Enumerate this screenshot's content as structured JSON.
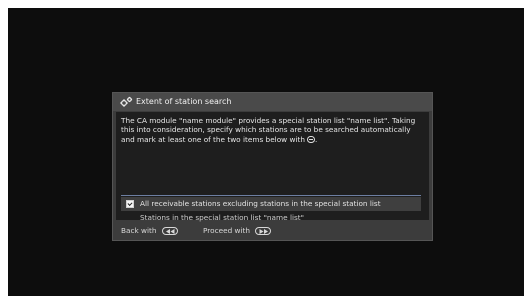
{
  "dialog": {
    "title": "Extent of station search",
    "title_icon": "gears-icon",
    "description": "The CA module \"name module\" provides a special station list \"name list\". Taking this into consideration, specify which stations are to be searched automatically and mark at least one of the two items below with",
    "description_end": ".",
    "ok_icon": "ok-button-icon"
  },
  "options": [
    {
      "label": "All receivable stations excluding stations in the special station list",
      "checked": true
    },
    {
      "label": "Stations in the special station list \"name list\""
    }
  ],
  "footer": {
    "back_label": "Back with",
    "back_icon": "rewind-key-icon",
    "proceed_label": "Proceed with",
    "proceed_icon": "fast-forward-key-icon"
  },
  "colors": {
    "screen_background": "#0d0d0d",
    "dialog_background": "#3c3c3c",
    "body_background": "#1e1e1e",
    "separator": "#6d7fa2"
  }
}
